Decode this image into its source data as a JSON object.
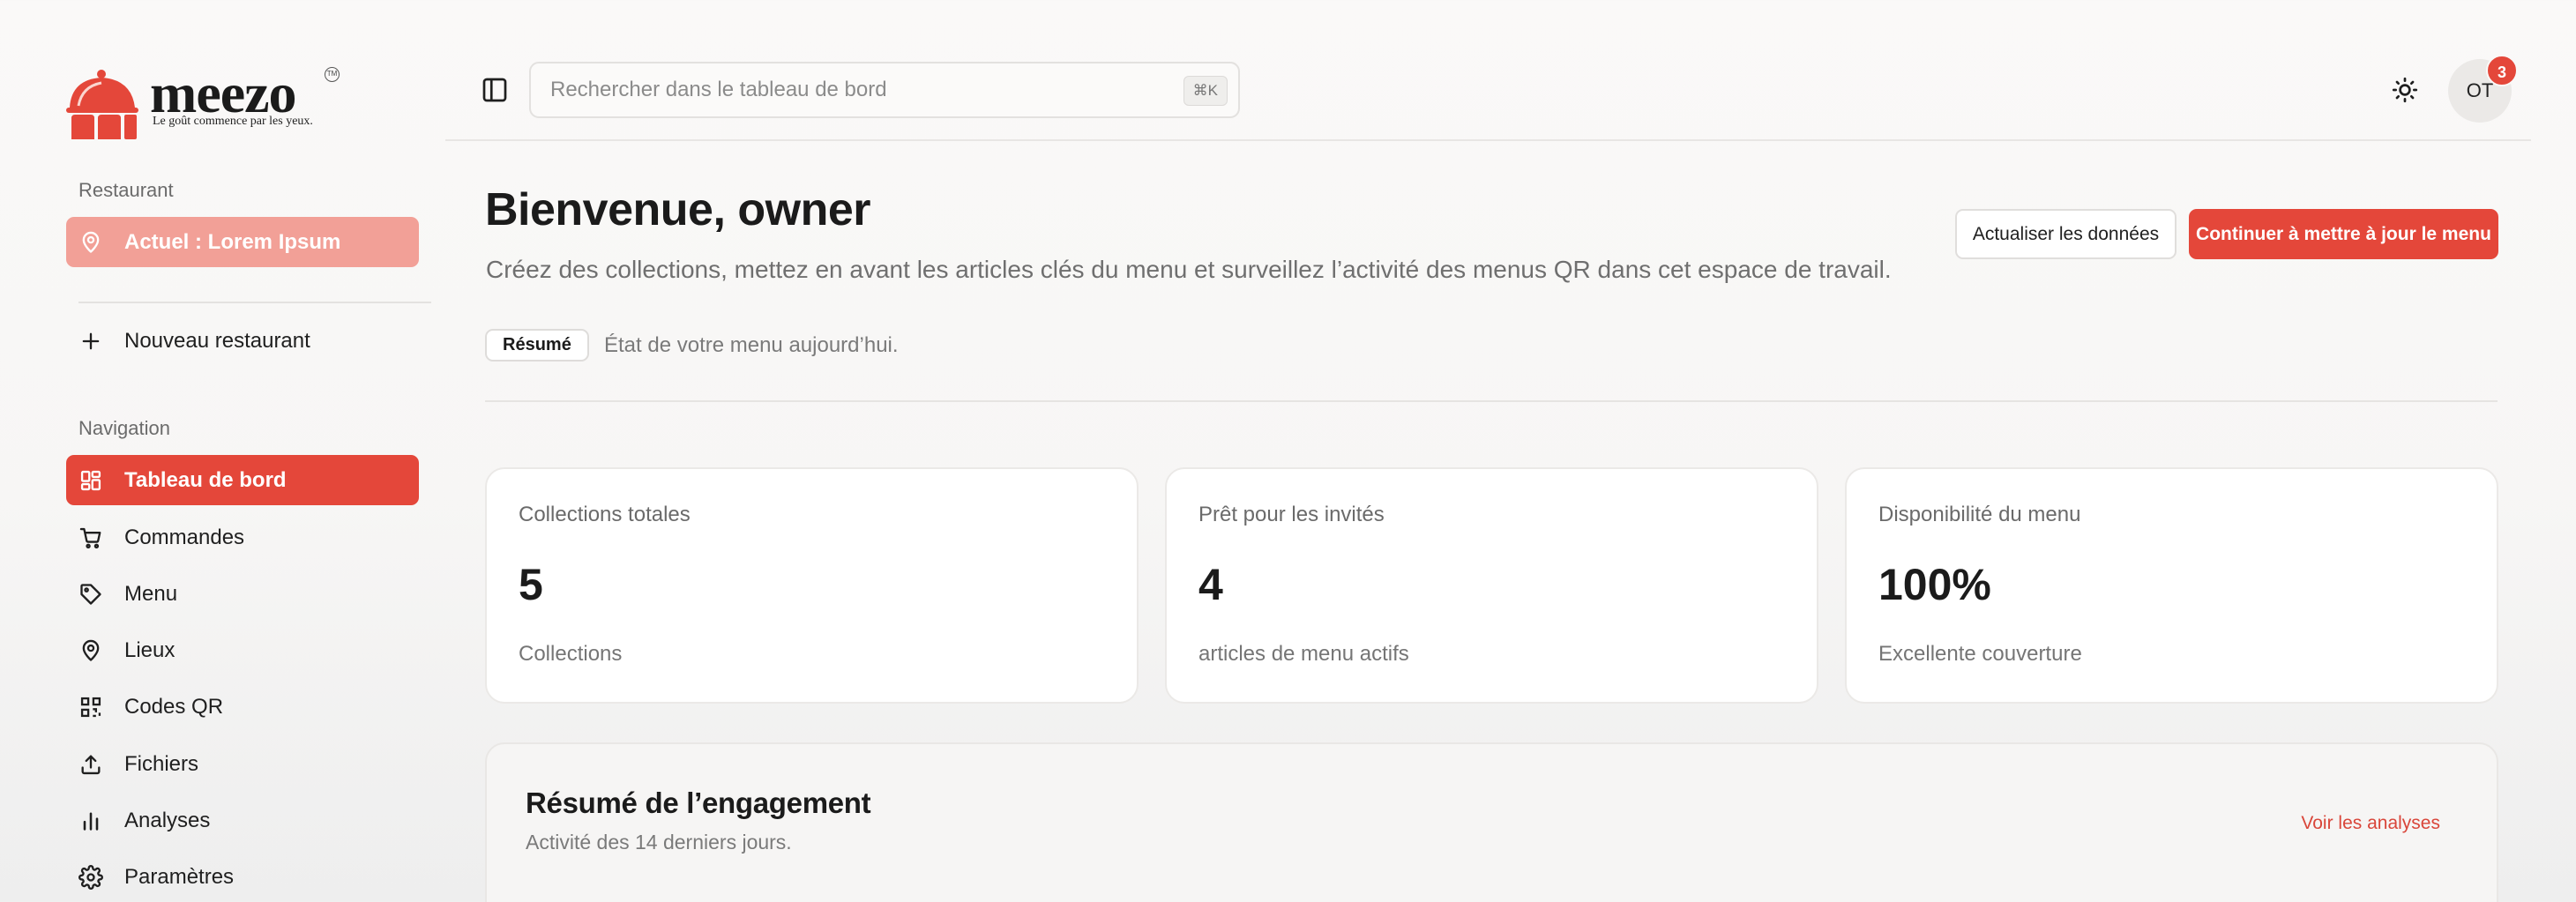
{
  "brand": {
    "name": "meezo",
    "trademark": "TM",
    "tagline": "Le goût commence par les yeux.",
    "accent_color": "#e4473a",
    "accent_light": "#f2a097"
  },
  "sidebar": {
    "restaurant_section_label": "Restaurant",
    "current_restaurant": {
      "label": "Actuel : Lorem Ipsum",
      "icon": "map-pin-icon"
    },
    "new_restaurant": {
      "label": "Nouveau restaurant",
      "icon": "plus-icon"
    },
    "navigation_section_label": "Navigation",
    "items": [
      {
        "label": "Tableau de bord",
        "icon": "dashboard-icon",
        "active": true
      },
      {
        "label": "Commandes",
        "icon": "cart-icon",
        "active": false
      },
      {
        "label": "Menu",
        "icon": "tag-icon",
        "active": false
      },
      {
        "label": "Lieux",
        "icon": "map-pin-icon",
        "active": false
      },
      {
        "label": "Codes QR",
        "icon": "qr-code-icon",
        "active": false
      },
      {
        "label": "Fichiers",
        "icon": "upload-icon",
        "active": false
      },
      {
        "label": "Analyses",
        "icon": "bar-chart-icon",
        "active": false
      },
      {
        "label": "Paramètres",
        "icon": "gear-icon",
        "active": false
      }
    ]
  },
  "topbar": {
    "search_placeholder": "Rechercher dans le tableau de bord",
    "search_shortcut": "⌘K",
    "user_initials": "OT",
    "notification_count": "3"
  },
  "main": {
    "title": "Bienvenue, owner",
    "subtitle": "Créez des collections, mettez en avant les articles clés du menu et surveillez l’activité des menus QR dans cet espace de travail.",
    "summary_badge": "Résumé",
    "summary_note": "État de votre menu aujourd’hui.",
    "refresh_button": "Actualiser les données",
    "continue_button": "Continuer à mettre à jour le menu",
    "stats": [
      {
        "title": "Collections totales",
        "value": "5",
        "desc": "Collections"
      },
      {
        "title": "Prêt pour les invités",
        "value": "4",
        "desc": "articles de menu actifs"
      },
      {
        "title": "Disponibilité du menu",
        "value": "100%",
        "desc": "Excellente couverture"
      }
    ],
    "engagement": {
      "title": "Résumé de l’engagement",
      "subtitle": "Activité des 14 derniers jours.",
      "link": "Voir les analyses"
    }
  }
}
